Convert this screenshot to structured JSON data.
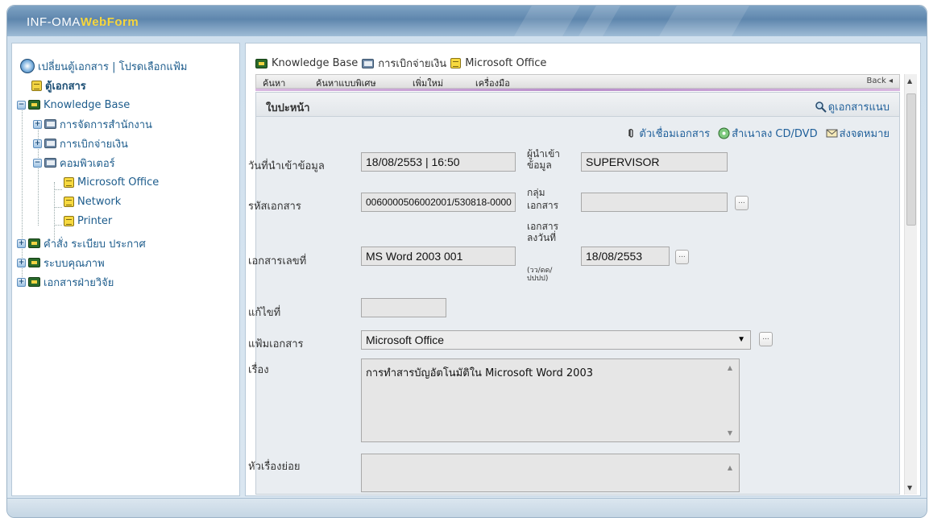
{
  "brand": {
    "part_a": "INF-OMA",
    "part_b": "WebForm"
  },
  "tree": {
    "header": "เปลี่ยนตู้เอกสาร | โปรดเลือกแฟ้ม",
    "root": "ตู้เอกสาร",
    "items": [
      {
        "label": "Knowledge Base",
        "expander": "−"
      },
      {
        "label": "การจัดการสำนักงาน",
        "expander": "+"
      },
      {
        "label": "การเบิกจ่ายเงิน",
        "expander": "+"
      },
      {
        "label": "คอมพิวเตอร์",
        "expander": "−"
      },
      {
        "label": "Microsoft Office"
      },
      {
        "label": "Network"
      },
      {
        "label": "Printer"
      },
      {
        "label": "คำสั่ง ระเบียบ ประกาศ",
        "expander": "+"
      },
      {
        "label": "ระบบคุณภาพ",
        "expander": "+"
      },
      {
        "label": "เอกสารฝ่ายวิจัย",
        "expander": "+"
      }
    ]
  },
  "breadcrumb": [
    "Knowledge Base",
    "การเบิกจ่ายเงิน",
    "Microsoft Office"
  ],
  "menu": {
    "search": "ค้นหา",
    "advanced_search": "ค้นหาแบบพิเศษ",
    "add_new": "เพิ่มใหม่",
    "tools": "เครื่องมือ",
    "back": "Back ◂"
  },
  "card": {
    "title": "ใบปะหน้า",
    "view_attachments": "ดูเอกสารแนบ",
    "link_docs": "ตัวเชื่อมเอกสาร",
    "copy_cd": "สำเนาลง CD/DVD",
    "send_mail": "ส่งจดหมาย"
  },
  "form": {
    "import_date_label": "วันที่นำเข้าข้อมูล",
    "import_date_value": "18/08/2553 | 16:50",
    "importer_label_1": "ผู้นำเข้า",
    "importer_label_2": "ข้อมูล",
    "importer_value": "SUPERVISOR",
    "doc_code_label": "รหัสเอกสาร",
    "doc_code_value": "0060000506002001/530818-0000",
    "doc_group_label_1": "กลุ่ม",
    "doc_group_label_2": "เอกสาร",
    "doc_group_value": "",
    "doc_no_label": "เอกสารเลขที่",
    "doc_no_value": "MS Word 2003 001",
    "doc_date_label_1": "เอกสาร",
    "doc_date_label_2": "ลงวันที่",
    "doc_date_hint_1": "(วว/ดด/",
    "doc_date_hint_2": "ปปปป)",
    "doc_date_value": "18/08/2553",
    "revision_label": "แก้ไขที่",
    "revision_value": "",
    "folder_label": "แฟ้มเอกสาร",
    "folder_value": "Microsoft Office",
    "subject_label": "เรื่อง",
    "subject_value": "การทำสารบัญอัตโนมัติใน Microsoft Word 2003",
    "subtopic_label": "หัวเรื่องย่อย",
    "subtopic_value": "",
    "more_button": "..."
  }
}
